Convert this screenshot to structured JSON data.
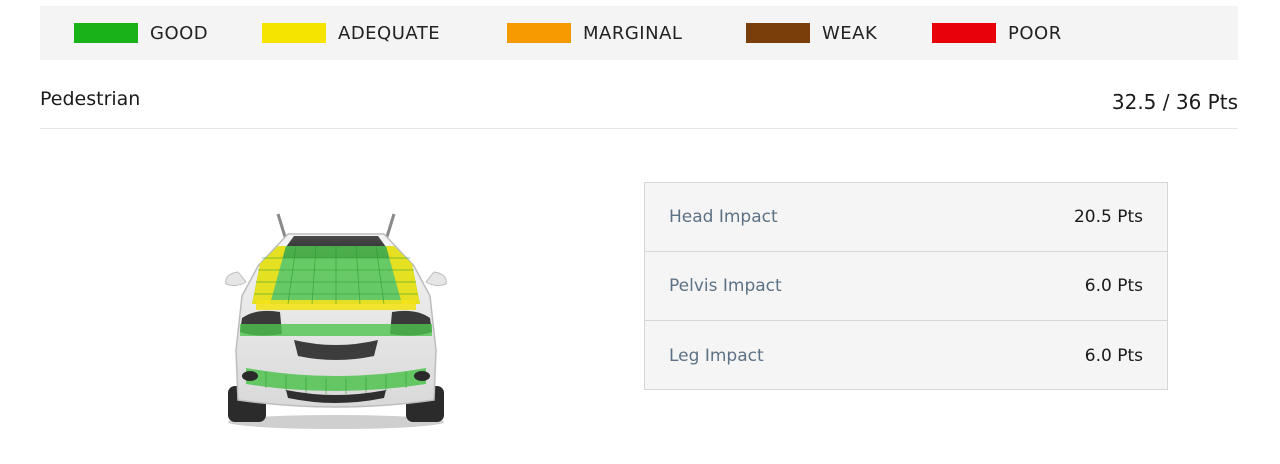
{
  "legend": [
    {
      "label": "GOOD",
      "color": "#19b319"
    },
    {
      "label": "ADEQUATE",
      "color": "#f5e400"
    },
    {
      "label": "MARGINAL",
      "color": "#f59a00"
    },
    {
      "label": "WEAK",
      "color": "#7a3e0a"
    },
    {
      "label": "POOR",
      "color": "#e8000b"
    }
  ],
  "section": {
    "title": "Pedestrian",
    "score": "32.5 / 36 Pts"
  },
  "car_illustration": {
    "icon": "car-front-pedestrian-zones-icon"
  },
  "impacts": [
    {
      "label": "Head Impact",
      "value": "20.5 Pts"
    },
    {
      "label": "Pelvis Impact",
      "value": "6.0 Pts"
    },
    {
      "label": "Leg Impact",
      "value": "6.0 Pts"
    }
  ]
}
